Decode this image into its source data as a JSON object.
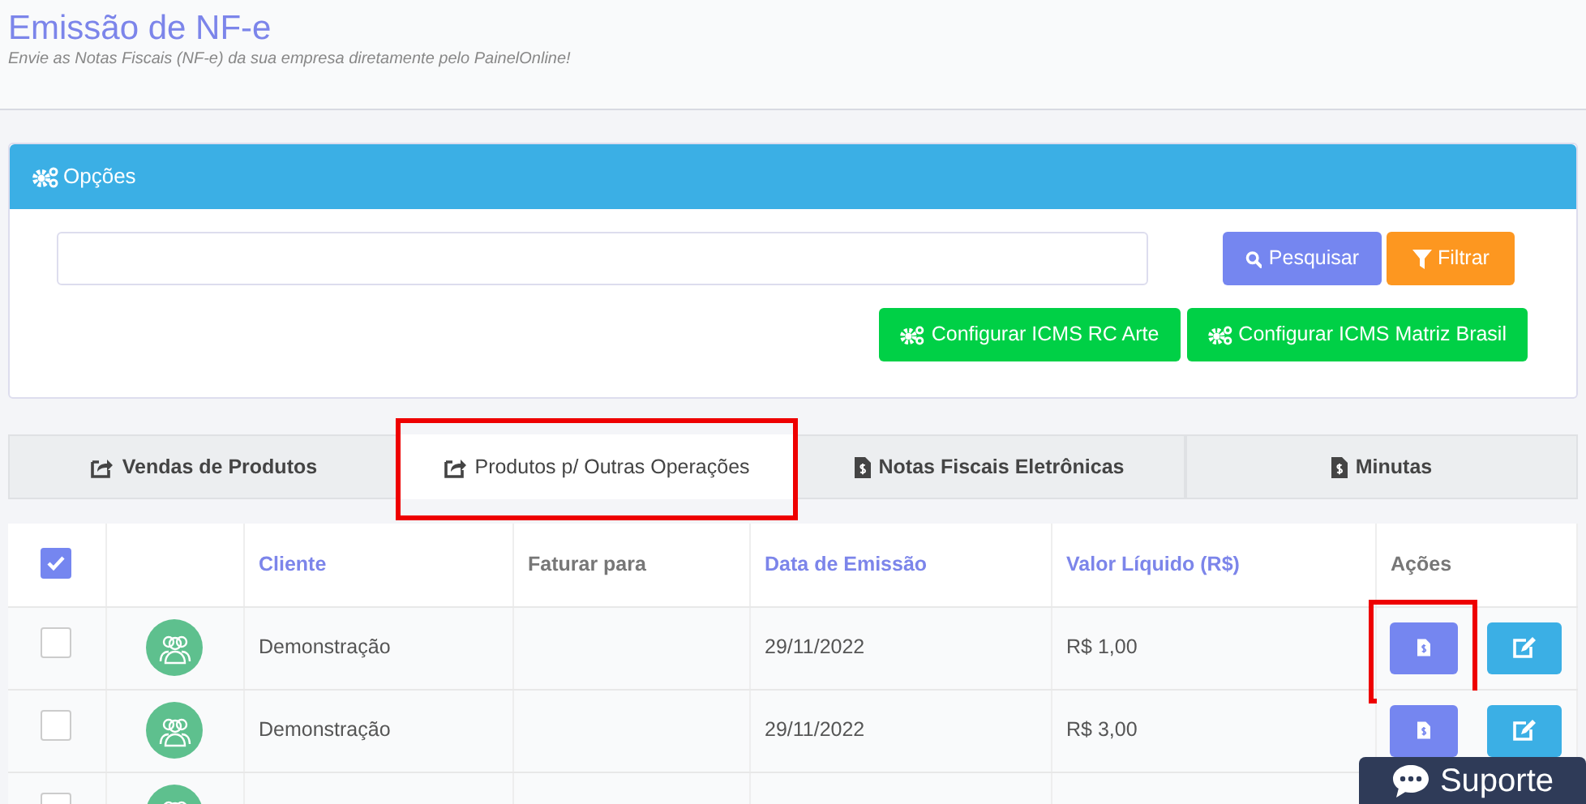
{
  "header": {
    "title": "Emissão de NF-e",
    "subtitle": "Envie as Notas Fiscais (NF-e) da sua empresa diretamente pelo PainelOnline!"
  },
  "options_panel": {
    "title": "Opções",
    "buttons": [
      {
        "label": "Pesquisar",
        "kind": "search"
      },
      {
        "label": "Filtrar",
        "kind": "filter"
      }
    ],
    "config_buttons": [
      {
        "label": "Configurar ICMS RC Arte"
      },
      {
        "label": "Configurar ICMS Matriz Brasil"
      }
    ]
  },
  "tabs": [
    {
      "label": "Vendas de Produtos",
      "selected": false,
      "highlighted": false
    },
    {
      "label": "Produtos p/ Outras Operações",
      "selected": true,
      "highlighted": true
    },
    {
      "label": "Notas Fiscais Eletrônicas",
      "selected": false,
      "highlighted": false
    },
    {
      "label": "Minutas",
      "selected": false,
      "highlighted": false
    }
  ],
  "table": {
    "select_all_checked": true,
    "columns": [
      {
        "label": "Cliente",
        "sortable": true
      },
      {
        "label": "Faturar para",
        "sortable": false
      },
      {
        "label": "Data de Emissão",
        "sortable": true
      },
      {
        "label": "Valor Líquido (R$)",
        "sortable": true
      },
      {
        "label": "Ações",
        "sortable": false
      }
    ],
    "rows": [
      {
        "checked": false,
        "cliente": "Demonstração",
        "data": "29/11/2022",
        "valor": "R$ 1,00",
        "invoice_highlighted": true
      },
      {
        "checked": false,
        "cliente": "Demonstração",
        "data": "29/11/2022",
        "valor": "R$ 3,00",
        "invoice_highlighted": false
      },
      {
        "checked": false
      }
    ]
  },
  "support_button": {
    "label": "Suporte"
  }
}
